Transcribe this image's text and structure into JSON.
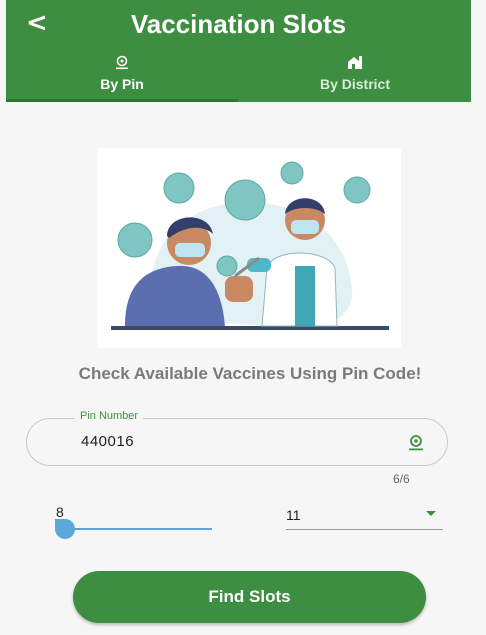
{
  "appbar": {
    "title": "Vaccination Slots",
    "back_icon": "back-arrow-icon",
    "background": "#3e8e41"
  },
  "tabs": [
    {
      "label": "By Pin",
      "icon": "location-pin-icon",
      "selected": true
    },
    {
      "label": "By District",
      "icon": "district-building-icon",
      "selected": false
    }
  ],
  "main": {
    "tagline": "Check Available Vaccines Using Pin Code!",
    "pin_field": {
      "label": "Pin Number",
      "value": "440016",
      "counter": "6/6",
      "icon": "location-pin-icon"
    },
    "slider": {
      "value": "8",
      "fraction": 0.0
    },
    "select": {
      "value": "11"
    },
    "find_button": "Find Slots"
  },
  "colors": {
    "accent": "#3e8e41",
    "slider": "#5aa7d8"
  }
}
